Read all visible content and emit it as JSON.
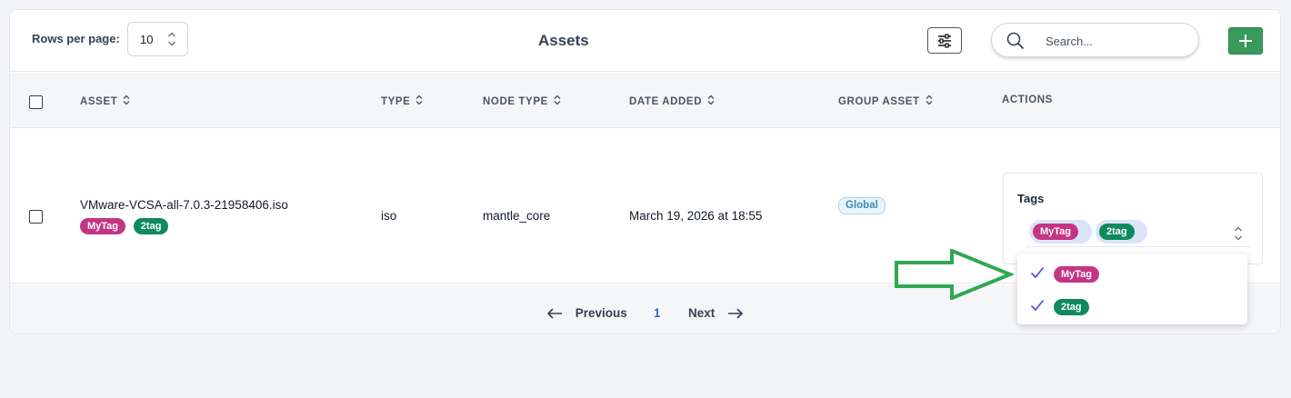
{
  "toolbar": {
    "rows_per_page_label": "Rows per page:",
    "rows_per_page_value": "10",
    "title": "Assets",
    "search_placeholder": "Search...",
    "add_icon": "plus-icon",
    "filter_icon": "sliders-icon"
  },
  "table": {
    "columns": [
      "ASSET",
      "TYPE",
      "NODE TYPE",
      "DATE ADDED",
      "GROUP ASSET",
      "ACTIONS"
    ],
    "rows": [
      {
        "asset": "VMware-VCSA-all-7.0.3-21958406.iso",
        "tags": [
          "MyTag",
          "2tag"
        ],
        "type": "iso",
        "node_type": "mantle_core",
        "date_added": "March 19, 2026 at 18:55",
        "group_asset": "Global",
        "actions": {
          "tags_label": "Tags",
          "selected_tags": [
            "MyTag",
            "2tag"
          ]
        }
      }
    ]
  },
  "dropdown": {
    "options": [
      {
        "label": "MyTag",
        "checked": true
      },
      {
        "label": "2tag",
        "checked": true
      }
    ]
  },
  "pagination": {
    "previous": "Previous",
    "current_page": "1",
    "next": "Next"
  },
  "colors": {
    "tag_mytag": "#c43583",
    "tag_2tag": "#0f8a5f",
    "add_button": "#3a9a5c",
    "annotation_arrow": "#2fa84f",
    "page_active": "#3b63c9"
  }
}
